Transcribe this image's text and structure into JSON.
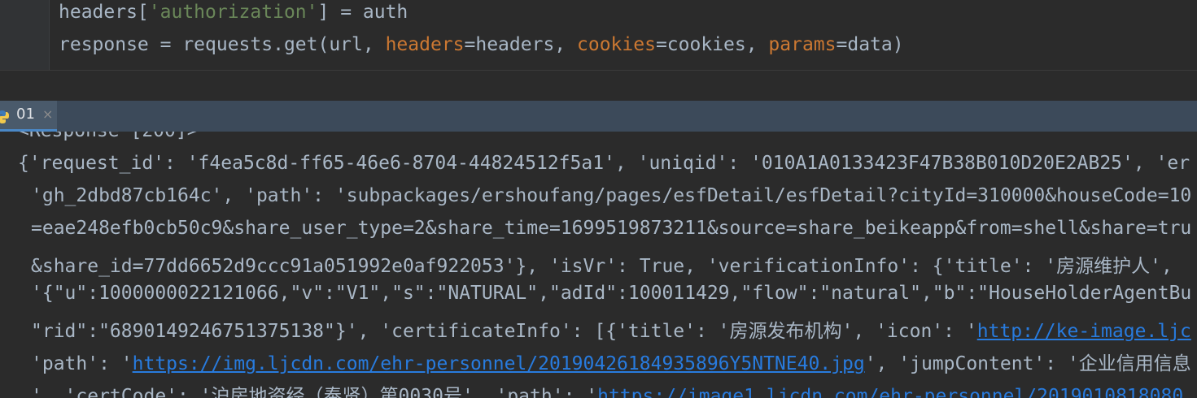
{
  "editor": {
    "line1": {
      "a": "headers[",
      "b": "'authorization'",
      "c": "] = auth"
    },
    "line2": {
      "a": "response = requests.get(url, ",
      "b": "headers",
      "c": "=headers, ",
      "d": "cookies",
      "e": "=cookies, ",
      "f": "params",
      "g": "=data)"
    }
  },
  "run_panel": {
    "tab_label": "01",
    "tab_close": "×"
  },
  "console": {
    "line0": "<Response [200]>",
    "line1": "{'request_id': 'f4ea5c8d-ff65-46e6-8704-44824512f5a1', 'uniqid': '010A1A0133423F47B38B010D20E2AB25', 'er",
    "line2": "'gh_2dbd87cb164c', 'path': 'subpackages/ershoufang/pages/esfDetail/esfDetail?cityId=310000&houseCode=10",
    "line3": "=eae248efb0cb50c9&share_user_type=2&share_time=1699519873211&source=share_beikeapp&from=shell&share=tru",
    "line4": "&share_id=77dd6652d9ccc91a051992e0af922053'}, 'isVr': True, 'verificationInfo': {'title': '房源维护人', ",
    "line5": "'{\"u\":1000000022121066,\"v\":\"V1\",\"s\":\"NATURAL\",\"adId\":100011429,\"flow\":\"natural\",\"b\":\"HouseHolderAgentBu",
    "line6a": "\"rid\":\"6890149246751375138\"}', 'certificateInfo': [{'title': '房源发布机构', 'icon': '",
    "line6b": "http://ke-image.ljc",
    "line7a": "'path': '",
    "line7b": "https://img.ljcdn.com/ehr-personnel/20190426184935896Y5NTNE40.jpg",
    "line7c": "', 'jumpContent': '企业信用信息",
    "line8a": "', 'certCode': '沪房地资经（奉贤）第0030号', 'path': '",
    "line8b": "https://image1.ljcdn.com/ehr-personnel/2019010818080"
  }
}
